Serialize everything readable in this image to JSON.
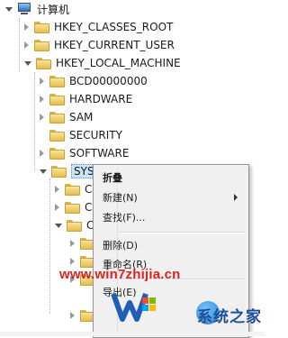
{
  "tree": {
    "root": "计算机",
    "items": [
      {
        "label": "HKEY_CLASSES_ROOT"
      },
      {
        "label": "HKEY_CURRENT_USER"
      },
      {
        "label": "HKEY_LOCAL_MACHINE"
      },
      {
        "label": "BCD00000000"
      },
      {
        "label": "HARDWARE"
      },
      {
        "label": "SAM"
      },
      {
        "label": "SECURITY"
      },
      {
        "label": "SOFTWARE"
      },
      {
        "label": "SYST"
      },
      {
        "label": "C"
      },
      {
        "label": "C"
      },
      {
        "label": "C"
      }
    ]
  },
  "context_menu": {
    "collapse": "折叠",
    "new": "新建(N)",
    "find": "查找(F)...",
    "delete": "删除(D)",
    "rename": "重命名(R)",
    "export": "导出(E)"
  },
  "watermark": {
    "url": "www.win7zhijia.cn",
    "brand": "系统之家"
  },
  "colors": {
    "watermark_red": "#e02020",
    "selection_blue": "#cce4f7",
    "folder_yellow": "#f3d57a"
  }
}
